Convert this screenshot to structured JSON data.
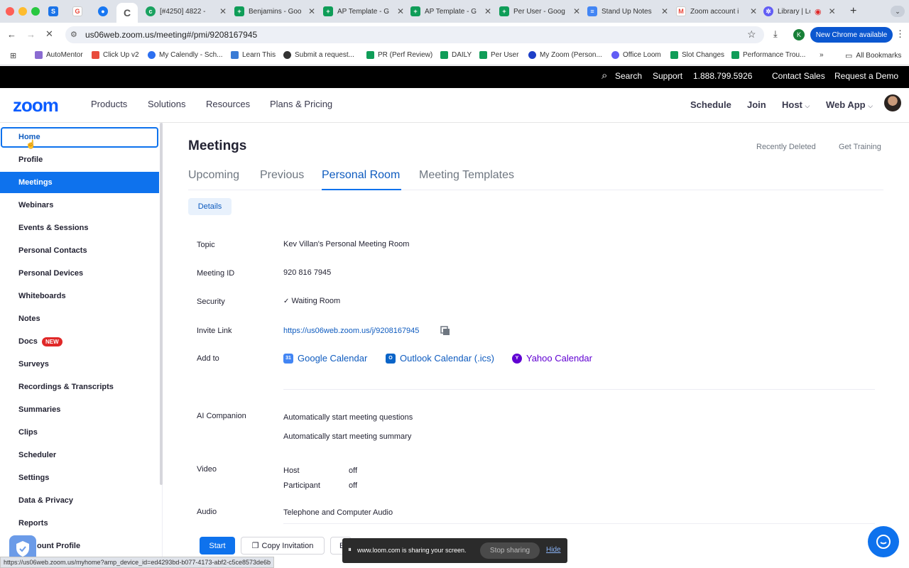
{
  "browser": {
    "tabs": [
      {
        "label": "",
        "favicon": "sheets-blue"
      },
      {
        "label": "",
        "favicon": "google"
      },
      {
        "label": "",
        "favicon": "messenger"
      },
      {
        "label": "",
        "favicon": "loading",
        "active": true
      },
      {
        "label": "[#4250] 4822 -",
        "favicon": "green-circle"
      },
      {
        "label": "Benjamins - Goo",
        "favicon": "sheets"
      },
      {
        "label": "AP Template - G",
        "favicon": "sheets"
      },
      {
        "label": "AP Template - G",
        "favicon": "sheets"
      },
      {
        "label": "Per User - Goog",
        "favicon": "sheets"
      },
      {
        "label": "Stand Up Notes",
        "favicon": "docs"
      },
      {
        "label": "Zoom account i",
        "favicon": "gmail"
      },
      {
        "label": "Library | Loo",
        "favicon": "loom"
      }
    ],
    "url": "us06web.zoom.us/meeting#/pmi/9208167945",
    "new_chrome": "New Chrome available",
    "profile_initial": "K",
    "bookmarks": [
      {
        "label": "AutoMentor",
        "color": "#8a6bd1"
      },
      {
        "label": "Click Up v2",
        "color": "#e84b3c"
      },
      {
        "label": "My Calendly - Sch...",
        "color": "#2c6ff0"
      },
      {
        "label": "Learn This",
        "color": "#3a7bd5"
      },
      {
        "label": "Submit a request...",
        "color": "#333333"
      },
      {
        "label": "PR (Perf Review)",
        "color": "#0f9d58"
      },
      {
        "label": "DAILY",
        "color": "#0f9d58"
      },
      {
        "label": "Per User",
        "color": "#0f9d58"
      },
      {
        "label": "My Zoom (Person...",
        "color": "#1d3fc7"
      },
      {
        "label": "Office Loom",
        "color": "#625df5"
      },
      {
        "label": "Slot Changes",
        "color": "#0f9d58"
      },
      {
        "label": "Performance Trou...",
        "color": "#0f9d58"
      }
    ],
    "more_bookmarks": "»",
    "all_bookmarks": "All Bookmarks",
    "status_url": "https://us06web.zoom.us/myhome?amp_device_id=ed4293bd-b077-4173-abf2-c5ce8573de6b"
  },
  "topbar": {
    "search": "Search",
    "support": "Support",
    "phone": "1.888.799.5926",
    "contact_sales": "Contact Sales",
    "request_demo": "Request a Demo"
  },
  "nav": {
    "logo": "zoom",
    "products": "Products",
    "solutions": "Solutions",
    "resources": "Resources",
    "plans": "Plans & Pricing",
    "schedule": "Schedule",
    "join": "Join",
    "host": "Host",
    "webapp": "Web App"
  },
  "sidebar": {
    "items": [
      {
        "label": "Home"
      },
      {
        "label": "Profile"
      },
      {
        "label": "Meetings"
      },
      {
        "label": "Webinars"
      },
      {
        "label": "Events & Sessions"
      },
      {
        "label": "Personal Contacts"
      },
      {
        "label": "Personal Devices"
      },
      {
        "label": "Whiteboards"
      },
      {
        "label": "Notes"
      },
      {
        "label": "Docs"
      },
      {
        "label": "Surveys"
      },
      {
        "label": "Recordings & Transcripts"
      },
      {
        "label": "Summaries"
      },
      {
        "label": "Clips"
      },
      {
        "label": "Scheduler"
      },
      {
        "label": "Settings"
      },
      {
        "label": "Data & Privacy"
      },
      {
        "label": "Reports"
      },
      {
        "label": "ount Profile"
      }
    ],
    "new_badge": "NEW"
  },
  "main": {
    "title": "Meetings",
    "recently_deleted": "Recently Deleted",
    "get_training": "Get Training",
    "tabs": [
      "Upcoming",
      "Previous",
      "Personal Room",
      "Meeting Templates"
    ],
    "details_tab": "Details",
    "topic_label": "Topic",
    "topic": "Kev Villan's Personal Meeting Room",
    "meeting_id_label": "Meeting ID",
    "meeting_id": "920 816 7945",
    "security_label": "Security",
    "security": "Waiting Room",
    "invite_label": "Invite Link",
    "invite_link": "https://us06web.zoom.us/j/9208167945",
    "add_to_label": "Add to",
    "google_cal": "Google Calendar",
    "outlook_cal": "Outlook Calendar (.ics)",
    "yahoo_cal": "Yahoo Calendar",
    "ai_label": "AI Companion",
    "ai_q": "Automatically start meeting questions",
    "ai_s": "Automatically start meeting summary",
    "video_label": "Video",
    "host_label": "Host",
    "host_val": "off",
    "participant_label": "Participant",
    "participant_val": "off",
    "audio_label": "Audio",
    "audio": "Telephone and Computer Audio",
    "start": "Start",
    "copy_invitation": "Copy Invitation",
    "edit_partial": "E"
  },
  "loom": {
    "message": "www.loom.com is sharing your screen.",
    "stop": "Stop sharing",
    "hide": "Hide"
  },
  "colors": {
    "zoom_blue": "#0e72ed",
    "link": "#0e5bbf",
    "yahoo": "#6001d2"
  }
}
